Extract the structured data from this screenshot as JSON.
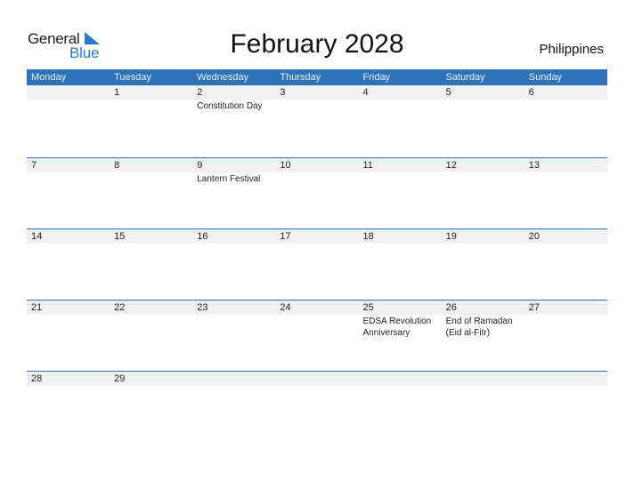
{
  "logo": {
    "word1": "General",
    "word2": "Blue",
    "accent": "#2a7ad0"
  },
  "title": "February 2028",
  "country": "Philippines",
  "colors": {
    "header_bg": "#2e73b8",
    "day_bg": "#f1f1f1"
  },
  "weekdays": [
    "Monday",
    "Tuesday",
    "Wednesday",
    "Thursday",
    "Friday",
    "Saturday",
    "Sunday"
  ],
  "weeks": [
    [
      {
        "day": "",
        "event": ""
      },
      {
        "day": "1",
        "event": ""
      },
      {
        "day": "2",
        "event": "Constitution Day"
      },
      {
        "day": "3",
        "event": ""
      },
      {
        "day": "4",
        "event": ""
      },
      {
        "day": "5",
        "event": ""
      },
      {
        "day": "6",
        "event": ""
      }
    ],
    [
      {
        "day": "7",
        "event": ""
      },
      {
        "day": "8",
        "event": ""
      },
      {
        "day": "9",
        "event": "Lantern Festival"
      },
      {
        "day": "10",
        "event": ""
      },
      {
        "day": "11",
        "event": ""
      },
      {
        "day": "12",
        "event": ""
      },
      {
        "day": "13",
        "event": ""
      }
    ],
    [
      {
        "day": "14",
        "event": ""
      },
      {
        "day": "15",
        "event": ""
      },
      {
        "day": "16",
        "event": ""
      },
      {
        "day": "17",
        "event": ""
      },
      {
        "day": "18",
        "event": ""
      },
      {
        "day": "19",
        "event": ""
      },
      {
        "day": "20",
        "event": ""
      }
    ],
    [
      {
        "day": "21",
        "event": ""
      },
      {
        "day": "22",
        "event": ""
      },
      {
        "day": "23",
        "event": ""
      },
      {
        "day": "24",
        "event": ""
      },
      {
        "day": "25",
        "event": "EDSA Revolution\nAnniversary"
      },
      {
        "day": "26",
        "event": "End of Ramadan\n(Eid al-Fitr)"
      },
      {
        "day": "27",
        "event": ""
      }
    ],
    [
      {
        "day": "28",
        "event": ""
      },
      {
        "day": "29",
        "event": ""
      },
      {
        "day": "",
        "event": ""
      },
      {
        "day": "",
        "event": ""
      },
      {
        "day": "",
        "event": ""
      },
      {
        "day": "",
        "event": ""
      },
      {
        "day": "",
        "event": ""
      }
    ]
  ]
}
